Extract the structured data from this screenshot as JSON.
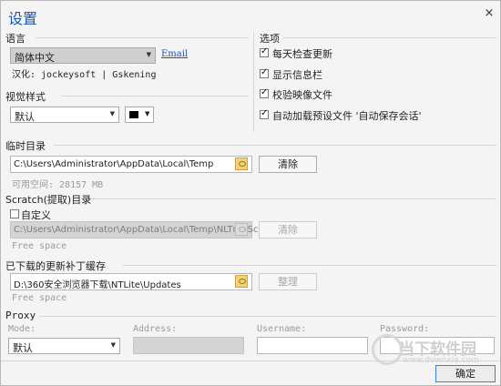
{
  "window": {
    "title": "设置",
    "close_glyph": "×"
  },
  "language": {
    "section_label": "语言",
    "selected": "简体中文",
    "email_link": "Email",
    "credits": "汉化: jockeysoft | Gskening"
  },
  "visual_style": {
    "section_label": "视觉样式",
    "selected": "默认",
    "color": "#000000"
  },
  "options": {
    "section_label": "选项",
    "items": [
      {
        "label": "每天检查更新",
        "checked": true
      },
      {
        "label": "显示信息栏",
        "checked": true
      },
      {
        "label": "校验映像文件",
        "checked": true
      },
      {
        "label": "自动加载预设文件 '自动保存会话'",
        "checked": true
      }
    ]
  },
  "temp_dir": {
    "section_label": "临时目录",
    "path": "C:\\Users\\Administrator\\AppData\\Local\\Temp",
    "free_space": "可用空间:  28157 MB",
    "clear_button": "清除"
  },
  "scratch_dir": {
    "section_label": "Scratch(提取)目录",
    "custom_label": "自定义",
    "custom_checked": false,
    "path": "C:\\Users\\Administrator\\AppData\\Local\\Temp\\NLTmpScratch",
    "free_space": "Free space",
    "clear_button": "清除"
  },
  "update_cache": {
    "section_label": "已下载的更新补丁缓存",
    "path": "D:\\360安全浏览器下载\\NTLite\\Updates",
    "free_space": "Free space",
    "organize_button": "整理"
  },
  "proxy": {
    "section_label": "Proxy",
    "mode_label": "Mode:",
    "mode_value": "默认",
    "address_label": "Address:",
    "username_label": "Username:",
    "password_label": "Password:"
  },
  "footer": {
    "ok_button": "确定"
  },
  "watermark": {
    "brand": "当下软件园",
    "site": "www.downxia.com"
  }
}
